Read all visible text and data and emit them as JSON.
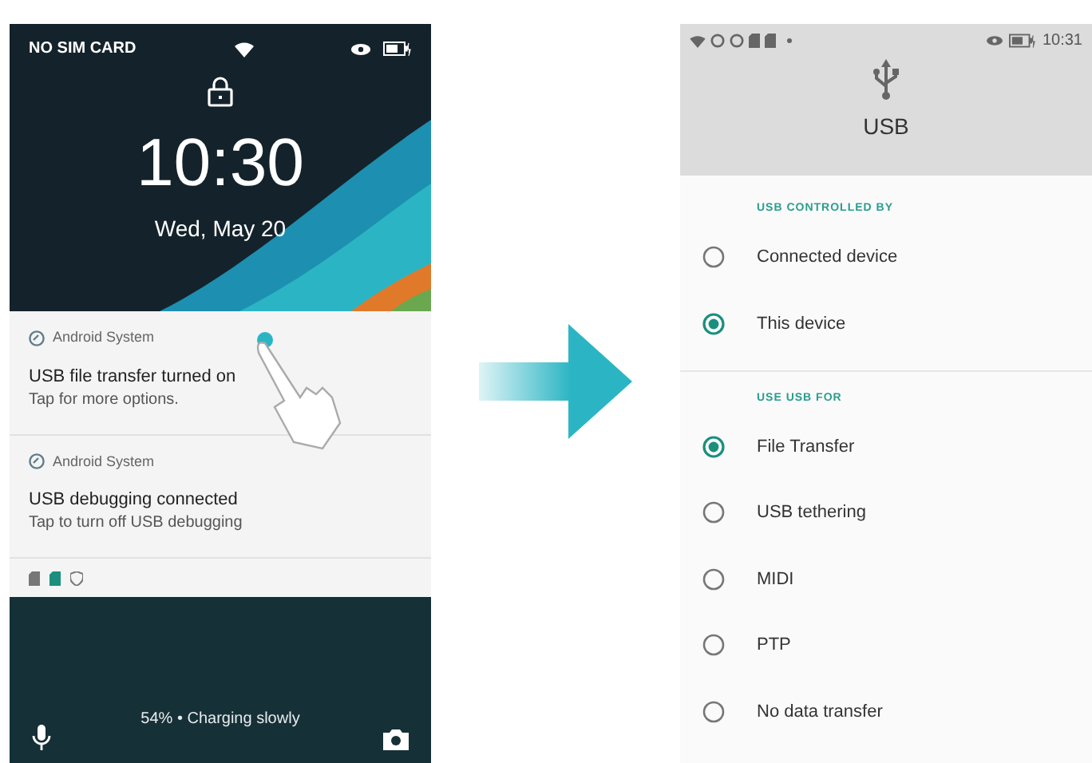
{
  "lock_screen": {
    "status_bar": {
      "carrier": "NO SIM CARD"
    },
    "time": "10:30",
    "date": "Wed, May 20",
    "notifications": [
      {
        "app": "Android System",
        "title": "USB file transfer turned on",
        "text": "Tap for more options."
      },
      {
        "app": "Android System",
        "title": "USB debugging connected",
        "text": "Tap to turn off USB debugging"
      }
    ],
    "charging": "54% • Charging slowly"
  },
  "usb_screen": {
    "status_bar": {
      "time": "10:31"
    },
    "title": "USB",
    "sections": [
      {
        "header": "USB CONTROLLED BY",
        "options": [
          {
            "label": "Connected device",
            "selected": false
          },
          {
            "label": "This device",
            "selected": true
          }
        ]
      },
      {
        "header": "USE USB FOR",
        "options": [
          {
            "label": "File Transfer",
            "selected": true
          },
          {
            "label": "USB tethering",
            "selected": false
          },
          {
            "label": "MIDI",
            "selected": false
          },
          {
            "label": "PTP",
            "selected": false
          },
          {
            "label": "No data transfer",
            "selected": false
          }
        ]
      }
    ]
  }
}
